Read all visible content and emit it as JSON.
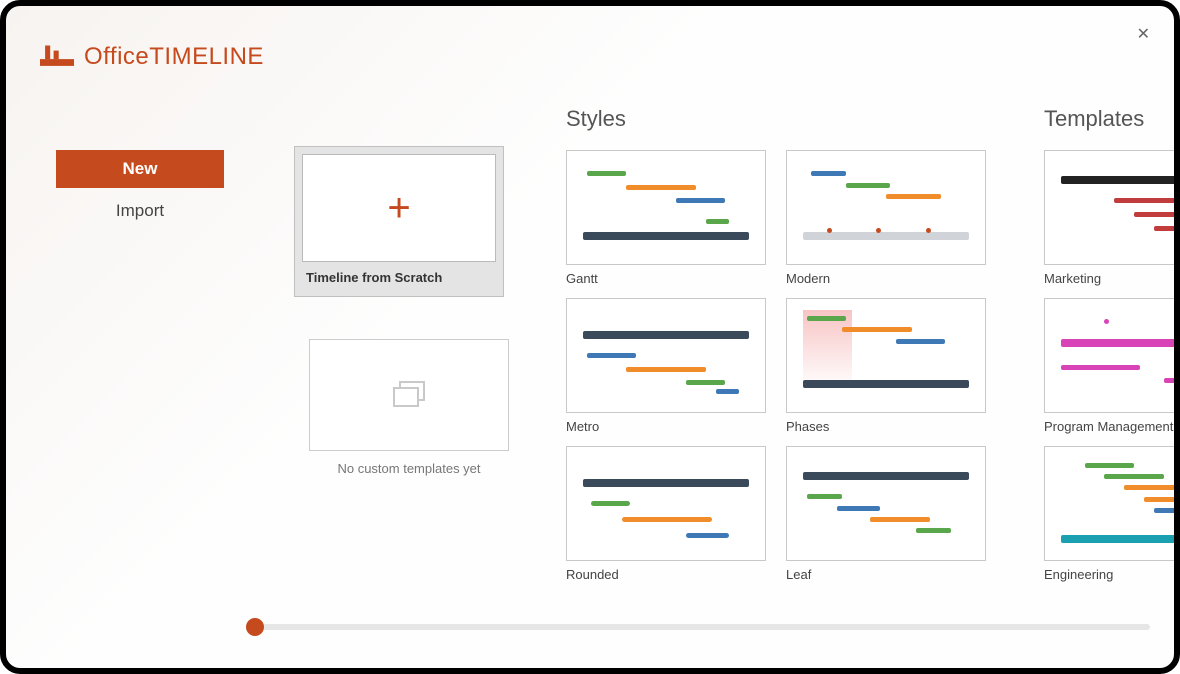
{
  "brand": {
    "name_light": "Office",
    "name_bold": "TIMELINE"
  },
  "close_glyph": "✕",
  "sidebar": {
    "items": [
      {
        "label": "New",
        "active": true
      },
      {
        "label": "Import",
        "active": false
      }
    ]
  },
  "scratch": {
    "label": "Timeline from Scratch",
    "plus_glyph": "+"
  },
  "no_custom_label": "No custom templates yet",
  "styles": {
    "title": "Styles",
    "items": [
      {
        "label": "Gantt"
      },
      {
        "label": "Modern"
      },
      {
        "label": "Metro"
      },
      {
        "label": "Phases"
      },
      {
        "label": "Rounded"
      },
      {
        "label": "Leaf"
      }
    ]
  },
  "templates": {
    "title": "Templates",
    "items": [
      {
        "label": "Marketing"
      },
      {
        "label": "Program Management"
      },
      {
        "label": "Engineering"
      }
    ]
  }
}
